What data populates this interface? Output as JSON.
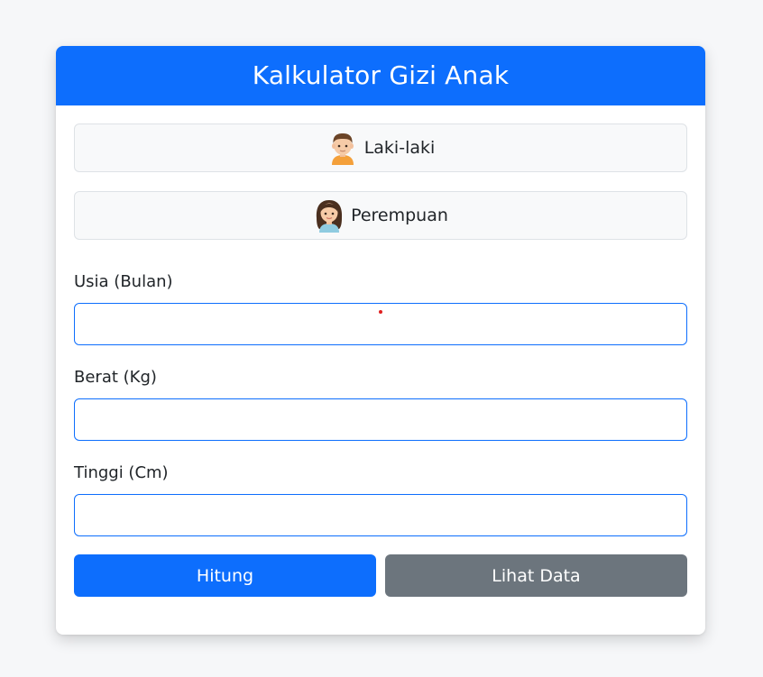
{
  "header": {
    "title": "Kalkulator Gizi Anak"
  },
  "gender": {
    "male": {
      "label": "Laki-laki",
      "icon": "boy-emoji-icon"
    },
    "female": {
      "label": "Perempuan",
      "icon": "girl-emoji-icon"
    }
  },
  "form": {
    "age": {
      "label": "Usia (Bulan)",
      "value": "",
      "placeholder": ""
    },
    "weight": {
      "label": "Berat (Kg)",
      "value": "",
      "placeholder": ""
    },
    "height": {
      "label": "Tinggi (Cm)",
      "value": "",
      "placeholder": ""
    }
  },
  "actions": {
    "calculate_label": "Hitung",
    "view_data_label": "Lihat Data"
  },
  "colors": {
    "primary": "#0d6efd",
    "secondary": "#6c757d",
    "background": "#f6f7f9"
  }
}
